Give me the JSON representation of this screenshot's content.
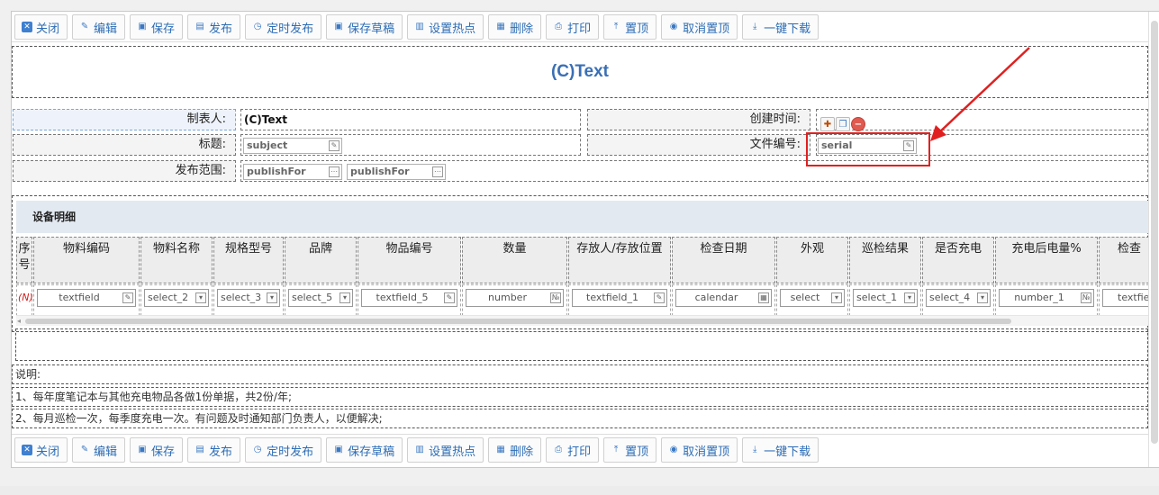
{
  "toolbar": {
    "buttons": [
      {
        "label": "关闭",
        "icon": "close-icon"
      },
      {
        "label": "编辑",
        "icon": "pencil-icon"
      },
      {
        "label": "保存",
        "icon": "save-icon"
      },
      {
        "label": "发布",
        "icon": "publish-icon"
      },
      {
        "label": "定时发布",
        "icon": "clock-icon"
      },
      {
        "label": "保存草稿",
        "icon": "draft-save-icon"
      },
      {
        "label": "设置热点",
        "icon": "hotspot-icon"
      },
      {
        "label": "删除",
        "icon": "trash-icon"
      },
      {
        "label": "打印",
        "icon": "printer-icon"
      },
      {
        "label": "置顶",
        "icon": "pin-top-icon"
      },
      {
        "label": "取消置顶",
        "icon": "unpin-icon"
      },
      {
        "label": "一键下载",
        "icon": "download-icon"
      }
    ]
  },
  "form": {
    "title": "(C)Text",
    "creator_label": "制表人:",
    "creator_value": "(C)Text",
    "created_time_label": "创建时间:",
    "subject_label": "标题:",
    "subject_field": "subject",
    "serial_label": "文件编号:",
    "serial_field": "serial",
    "publish_scope_label": "发布范围:",
    "publish_for_1": "publishFor",
    "publish_for_2": "publishFor"
  },
  "detail": {
    "heading": "设备明细",
    "index_placeholder": "(N)",
    "columns": [
      {
        "header": "序号",
        "field": ""
      },
      {
        "header": "物料编码",
        "field": "textfield"
      },
      {
        "header": "物料名称",
        "field": "select_2"
      },
      {
        "header": "规格型号",
        "field": "select_3"
      },
      {
        "header": "品牌",
        "field": "select_5"
      },
      {
        "header": "物品编号",
        "field": "textfield_5"
      },
      {
        "header": "数量",
        "field": "number"
      },
      {
        "header": "存放人/存放位置",
        "field": "textfield_1"
      },
      {
        "header": "检查日期",
        "field": "calendar"
      },
      {
        "header": "外观",
        "field": "select"
      },
      {
        "header": "巡检结果",
        "field": "select_1"
      },
      {
        "header": "是否充电",
        "field": "select_4"
      },
      {
        "header": "充电后电量%",
        "field": "number_1"
      },
      {
        "header": "检查",
        "field": "textfiel"
      }
    ]
  },
  "notes": {
    "heading": "说明:",
    "line1": "1、每年度笔记本与其他充电物品各做1份单据，共2份/年;",
    "line2": "2、每月巡检一次，每季度充电一次。有问题及时通知部门负责人，以便解决;"
  },
  "colors": {
    "accent": "#2d6db5",
    "title": "#3a6fb5",
    "highlight": "#e02020",
    "section_bg": "#e3e9f1"
  }
}
